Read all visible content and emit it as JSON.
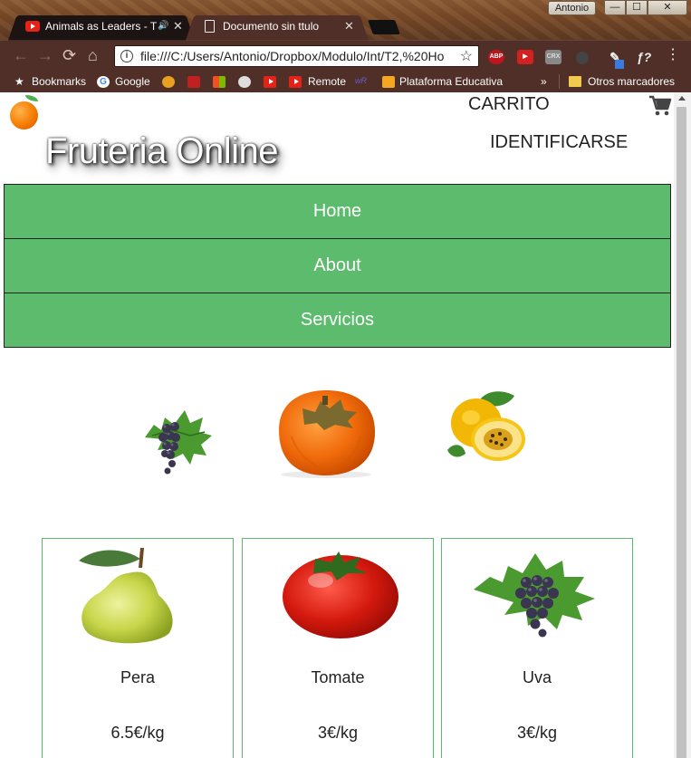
{
  "window": {
    "user_label": "Antonio",
    "minimize": "—",
    "maximize": "☐",
    "close": "✕"
  },
  "tabs": [
    {
      "label": "Animals as Leaders - T",
      "favicon": "youtube-icon",
      "audio": "🔊",
      "close": "✕"
    },
    {
      "label": "Documento sin ttulo",
      "favicon": "document-icon",
      "close": "✕"
    }
  ],
  "toolbar": {
    "back": "←",
    "forward": "→",
    "reload": "⟳",
    "home": "⌂",
    "url": "file:///C:/Users/Antonio/Dropbox/Modulo/Int/T2,%20Ho",
    "star": "☆",
    "extensions": [
      {
        "name": "adblock-plus-icon",
        "label": "ABP"
      },
      {
        "name": "youtube-ext-icon",
        "label": "▶"
      },
      {
        "name": "crx-icon",
        "label": "CRX"
      },
      {
        "name": "disc-icon",
        "label": ""
      },
      {
        "name": "pen-icon",
        "label": "✎"
      },
      {
        "name": "function-icon",
        "label": "ƒ?"
      }
    ],
    "menu": "⋮"
  },
  "bookmarks": {
    "items": [
      {
        "label": "Bookmarks",
        "icon": "star-icon"
      },
      {
        "label": "Google",
        "icon": "google-icon"
      },
      {
        "label": "Remote",
        "icon": "youtube-icon"
      },
      {
        "label": "Plataforma Educativa",
        "icon": "education-icon"
      }
    ],
    "overflow": "»",
    "other": "Otros marcadores"
  },
  "page": {
    "title": "Fruteria Online",
    "cart_link": "CARRITO",
    "login_link": "IDENTIFICARSE",
    "nav": [
      "Home",
      "About",
      "Servicios"
    ],
    "featured": [
      "grapes-image",
      "persimmon-image",
      "passion-fruit-image"
    ],
    "products": [
      {
        "name": "Pera",
        "price": "6.5€/kg",
        "image": "pear-image"
      },
      {
        "name": "Tomate",
        "price": "3€/kg",
        "image": "tomato-image"
      },
      {
        "name": "Uva",
        "price": "3€/kg",
        "image": "grapes-image"
      }
    ]
  },
  "colors": {
    "nav_green": "#5dbb6d",
    "card_border": "#5dbb6d",
    "chrome_bg": "#4f2f28"
  }
}
